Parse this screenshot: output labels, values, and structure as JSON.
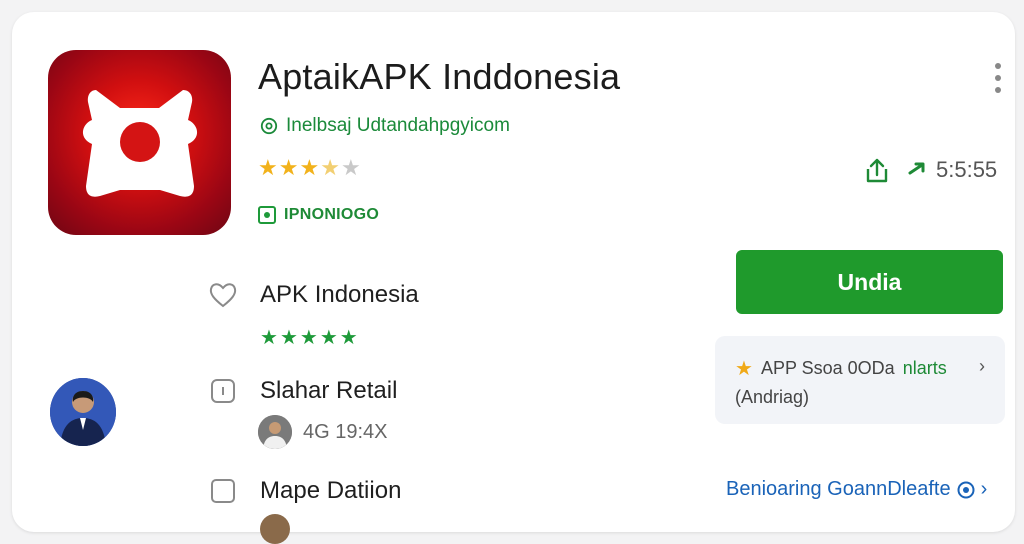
{
  "app": {
    "title": "AptaikAPK Inddonesia",
    "developer_link": "Inelbsaj Udtandahpgyicom",
    "rating_stars": 3.5,
    "badge_text": "IPNONIOGO",
    "download_count": "5:5:55"
  },
  "install_button": {
    "label": "Undia"
  },
  "promo": {
    "line1_a": "APP Ssoa 0ODa",
    "line1_b": "nlarts",
    "line2": "(Andriag)"
  },
  "list": {
    "item1_label": "APK Indonesia",
    "item1_stars": 5,
    "item2_label": "Slahar Retail",
    "item2_meta": "4G 19:4X",
    "item3_label": "Mape Datiion"
  },
  "more_link": {
    "label": "Benioaring GoannDleafte"
  },
  "colors": {
    "accent_green": "#1f9a2c",
    "star_gold": "#f2b21b",
    "icon_red": "#d10f10",
    "link_blue": "#1a63b8"
  },
  "icons": {
    "more": "more-vert-icon",
    "share": "share-icon",
    "download": "arrow-icon",
    "heart": "heart-icon",
    "info": "info-icon",
    "checkbox": "checkbox-icon",
    "verified": "verified-icon",
    "chevron": "chevron-right-icon"
  }
}
